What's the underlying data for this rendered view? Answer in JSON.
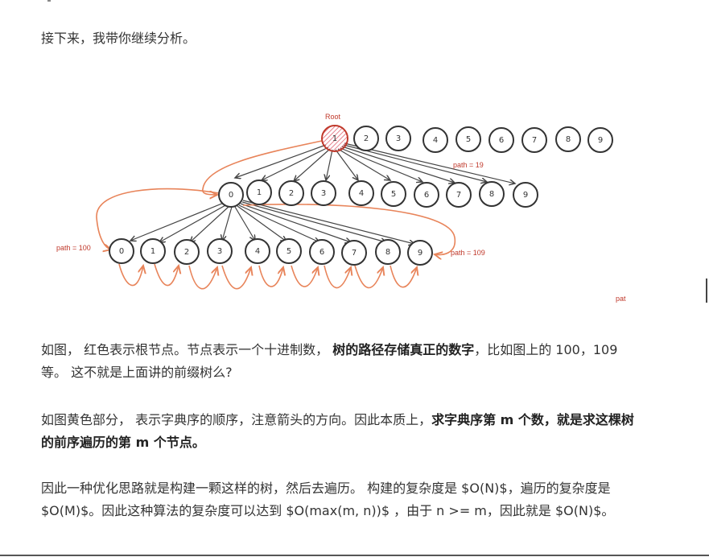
{
  "intro": "接下来，我带你继续分析。",
  "diagram": {
    "root_label": "Root",
    "level1_nodes": [
      "1",
      "2",
      "3",
      "4",
      "5",
      "6",
      "7",
      "8",
      "9"
    ],
    "level2_nodes": [
      "0",
      "1",
      "2",
      "3",
      "4",
      "5",
      "6",
      "7",
      "8",
      "9"
    ],
    "level3_nodes": [
      "0",
      "1",
      "2",
      "3",
      "4",
      "5",
      "6",
      "7",
      "8",
      "9"
    ],
    "path_19": "path = 19",
    "path_100": "path = 100",
    "path_109": "path = 109",
    "pat": "pat"
  },
  "p1": {
    "a": "如图， 红色表示根节点。节点表示一个十进制数， ",
    "b": "树的路径存储真正的数字",
    "c": "，比如图上的 100，109 等。 这不就是上面讲的前缀树么?"
  },
  "p2": {
    "a": "如图黄色部分， 表示字典序的顺序，注意箭头的方向。因此本质上，",
    "b": "求字典序第 m 个数，就是求这棵树的前序遍历的第 m 个节点。"
  },
  "p3": "因此一种优化思路就是构建一颗这样的树，然后去遍历。 构建的复杂度是 $O(N)$，遍历的复杂度是 $O(M)$。因此这种算法的复杂度可以达到 $O(max(m, n))$ ，由于 n >= m，因此就是 $O(N)$。"
}
